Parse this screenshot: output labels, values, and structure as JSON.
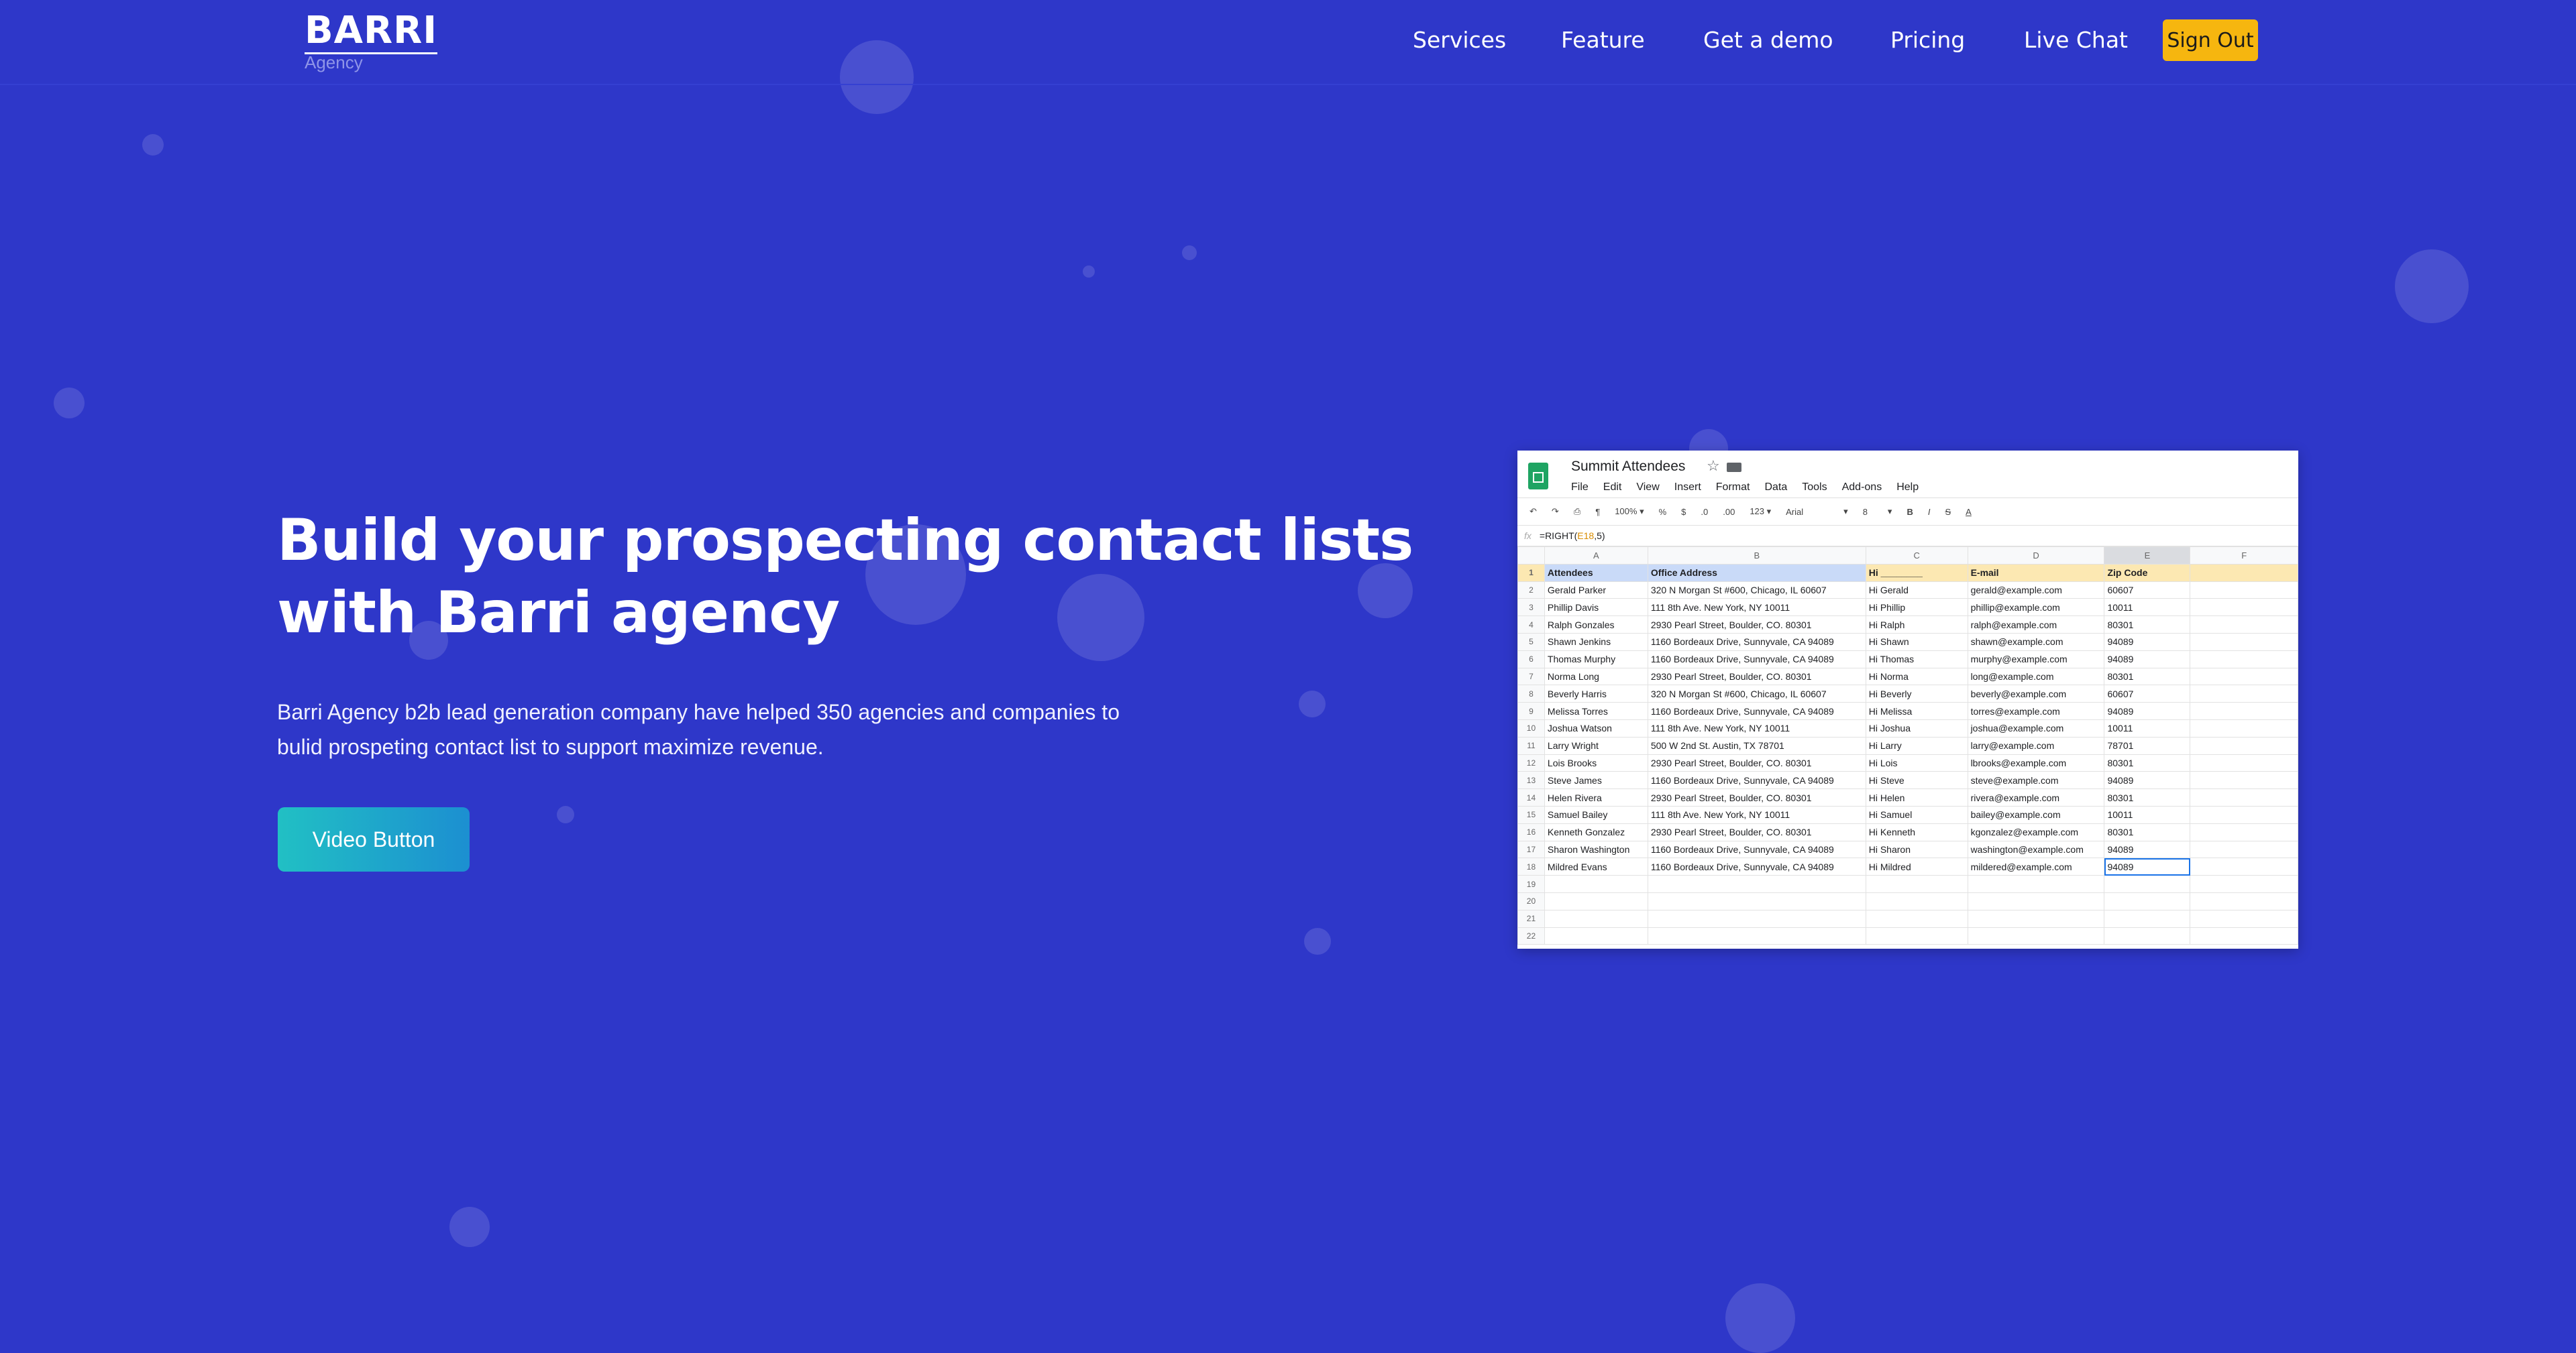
{
  "brand": {
    "name": "BARRI",
    "sub": "Agency"
  },
  "nav": {
    "items": [
      "Services",
      "Feature",
      "Get a demo",
      "Pricing",
      "Live Chat"
    ],
    "signout": "Sign Out"
  },
  "hero": {
    "title_line1": "Build your prospecting contact lists",
    "title_line2": "with Barri agency",
    "desc_line1": "Barri Agency b2b lead generation company have helped 350 agencies and companies to",
    "desc_line2": "bulid prospeting contact list to support maximize revenue.",
    "button": "Video Button"
  },
  "sheet": {
    "title": "Summit Attendees",
    "menu": [
      "File",
      "Edit",
      "View",
      "Insert",
      "Format",
      "Data",
      "Tools",
      "Add-ons",
      "Help"
    ],
    "toolbar": [
      "↶",
      "↷",
      "⎙",
      "¶",
      "100% ▾",
      "%",
      "$",
      ".0",
      ".00",
      "123 ▾",
      "Arial",
      "▾",
      "8",
      "▾",
      "B",
      "I",
      "S",
      "A"
    ],
    "formula_prefix": "=RIGHT(",
    "formula_ref": "E18",
    "formula_suffix": ",5)",
    "columns": [
      "A",
      "B",
      "C",
      "D",
      "E",
      "F"
    ],
    "header": [
      "Attendees",
      "Office Address",
      "Hi ________",
      "E-mail",
      "Zip Code",
      ""
    ],
    "rows": [
      [
        "Gerald Parker",
        "320 N Morgan St #600, Chicago, IL 60607",
        "Hi Gerald",
        "gerald@example.com",
        "60607"
      ],
      [
        "Phillip Davis",
        "111 8th Ave. New York, NY 10011",
        "Hi Phillip",
        "phillip@example.com",
        "10011"
      ],
      [
        "Ralph Gonzales",
        "2930 Pearl Street, Boulder, CO. 80301",
        "Hi Ralph",
        "ralph@example.com",
        "80301"
      ],
      [
        "Shawn Jenkins",
        "1160 Bordeaux Drive, Sunnyvale, CA 94089",
        "Hi Shawn",
        "shawn@example.com",
        "94089"
      ],
      [
        "Thomas Murphy",
        "1160 Bordeaux Drive, Sunnyvale, CA 94089",
        "Hi Thomas",
        "murphy@example.com",
        "94089"
      ],
      [
        "Norma Long",
        "2930 Pearl Street, Boulder, CO. 80301",
        "Hi Norma",
        "long@example.com",
        "80301"
      ],
      [
        "Beverly Harris",
        "320 N Morgan St #600, Chicago, IL 60607",
        "Hi Beverly",
        "beverly@example.com",
        "60607"
      ],
      [
        "Melissa Torres",
        "1160 Bordeaux Drive, Sunnyvale, CA 94089",
        "Hi Melissa",
        "torres@example.com",
        "94089"
      ],
      [
        "Joshua Watson",
        "111 8th Ave. New York, NY 10011",
        "Hi Joshua",
        "joshua@example.com",
        "10011"
      ],
      [
        "Larry Wright",
        "500 W 2nd St. Austin, TX 78701",
        "Hi Larry",
        "larry@example.com",
        "78701"
      ],
      [
        "Lois Brooks",
        "2930 Pearl Street, Boulder, CO. 80301",
        "Hi Lois",
        "lbrooks@example.com",
        "80301"
      ],
      [
        "Steve James",
        "1160 Bordeaux Drive, Sunnyvale, CA 94089",
        "Hi Steve",
        "steve@example.com",
        "94089"
      ],
      [
        "Helen Rivera",
        "2930 Pearl Street, Boulder, CO. 80301",
        "Hi Helen",
        "rivera@example.com",
        "80301"
      ],
      [
        "Samuel Bailey",
        "111 8th Ave. New York, NY 10011",
        "Hi Samuel",
        "bailey@example.com",
        "10011"
      ],
      [
        "Kenneth Gonzalez",
        "2930 Pearl Street, Boulder, CO. 80301",
        "Hi Kenneth",
        "kgonzalez@example.com",
        "80301"
      ],
      [
        "Sharon Washington",
        "1160 Bordeaux Drive, Sunnyvale, CA 94089",
        "Hi Sharon",
        "washington@example.com",
        "94089"
      ],
      [
        "Mildred Evans",
        "1160 Bordeaux Drive, Sunnyvale, CA 94089",
        "Hi Mildred",
        "mildered@example.com",
        "94089"
      ]
    ],
    "row_numbers": [
      "1",
      "2",
      "3",
      "4",
      "5",
      "6",
      "7",
      "8",
      "9",
      "10",
      "11",
      "12",
      "13",
      "14",
      "15",
      "16",
      "17",
      "18",
      "19",
      "20",
      "21",
      "22"
    ]
  },
  "colors": {
    "background": "#2e37c9",
    "signout": "#f6b60f",
    "button_start": "#21c0c4",
    "button_end": "#1c8fd1"
  }
}
